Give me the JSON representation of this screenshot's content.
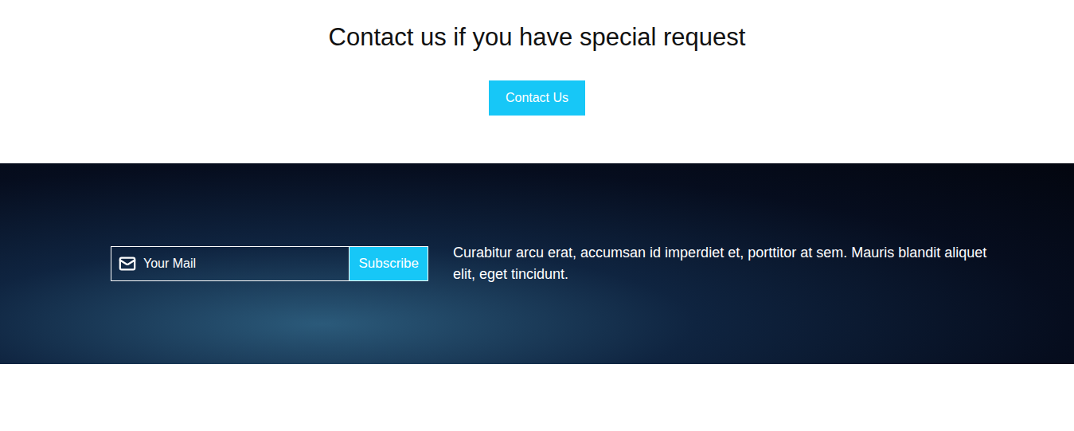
{
  "contact": {
    "heading": "Contact us if you have special request",
    "button": "Contact Us"
  },
  "newsletter": {
    "placeholder": "Your Mail",
    "button": "Subscribe",
    "description": "Curabitur arcu erat, accumsan id imperdiet et, porttitor at sem. Mauris blandit aliquet elit, eget tincidunt."
  }
}
